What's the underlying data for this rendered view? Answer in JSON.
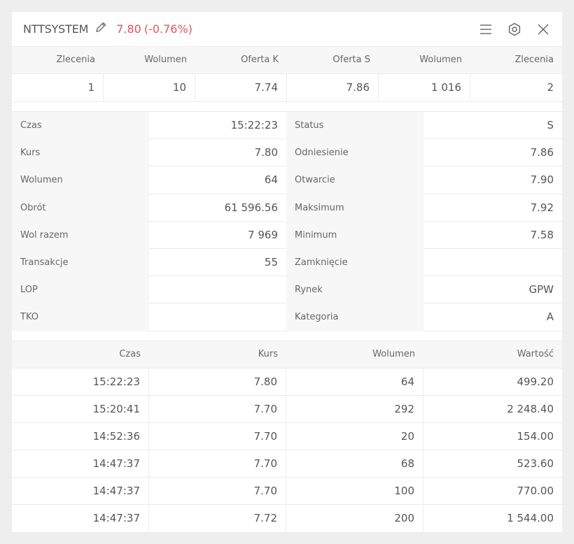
{
  "header": {
    "ticker": "NTTSYSTEM",
    "price": "7.80",
    "change": "(-0.76%)",
    "accent_color": "#e2555b",
    "icons": [
      "pencil-icon",
      "menu-icon",
      "settings-icon",
      "close-icon"
    ]
  },
  "order_book": {
    "columns": [
      "Zlecenia",
      "Wolumen",
      "Oferta K",
      "Oferta S",
      "Wolumen",
      "Zlecenia"
    ],
    "row": [
      "1",
      "10",
      "7.74",
      "7.86",
      "1 016",
      "2"
    ]
  },
  "details": {
    "left": [
      {
        "label": "Czas",
        "value": "15:22:23"
      },
      {
        "label": "Kurs",
        "value": "7.80"
      },
      {
        "label": "Wolumen",
        "value": "64"
      },
      {
        "label": "Obrót",
        "value": "61 596.56"
      },
      {
        "label": "Wol razem",
        "value": "7 969"
      },
      {
        "label": "Transakcje",
        "value": "55"
      },
      {
        "label": "LOP",
        "value": ""
      },
      {
        "label": "TKO",
        "value": ""
      }
    ],
    "right": [
      {
        "label": "Status",
        "value": "S"
      },
      {
        "label": "Odniesienie",
        "value": "7.86"
      },
      {
        "label": "Otwarcie",
        "value": "7.90"
      },
      {
        "label": "Maksimum",
        "value": "7.92"
      },
      {
        "label": "Minimum",
        "value": "7.58"
      },
      {
        "label": "Zamknięcie",
        "value": ""
      },
      {
        "label": "Rynek",
        "value": "GPW"
      },
      {
        "label": "Kategoria",
        "value": "A"
      }
    ]
  },
  "trades": {
    "columns": [
      "Czas",
      "Kurs",
      "Wolumen",
      "Wartość"
    ],
    "rows": [
      [
        "15:22:23",
        "7.80",
        "64",
        "499.20"
      ],
      [
        "15:20:41",
        "7.70",
        "292",
        "2 248.40"
      ],
      [
        "14:52:36",
        "7.70",
        "20",
        "154.00"
      ],
      [
        "14:47:37",
        "7.70",
        "68",
        "523.60"
      ],
      [
        "14:47:37",
        "7.70",
        "100",
        "770.00"
      ],
      [
        "14:47:37",
        "7.72",
        "200",
        "1 544.00"
      ]
    ]
  }
}
